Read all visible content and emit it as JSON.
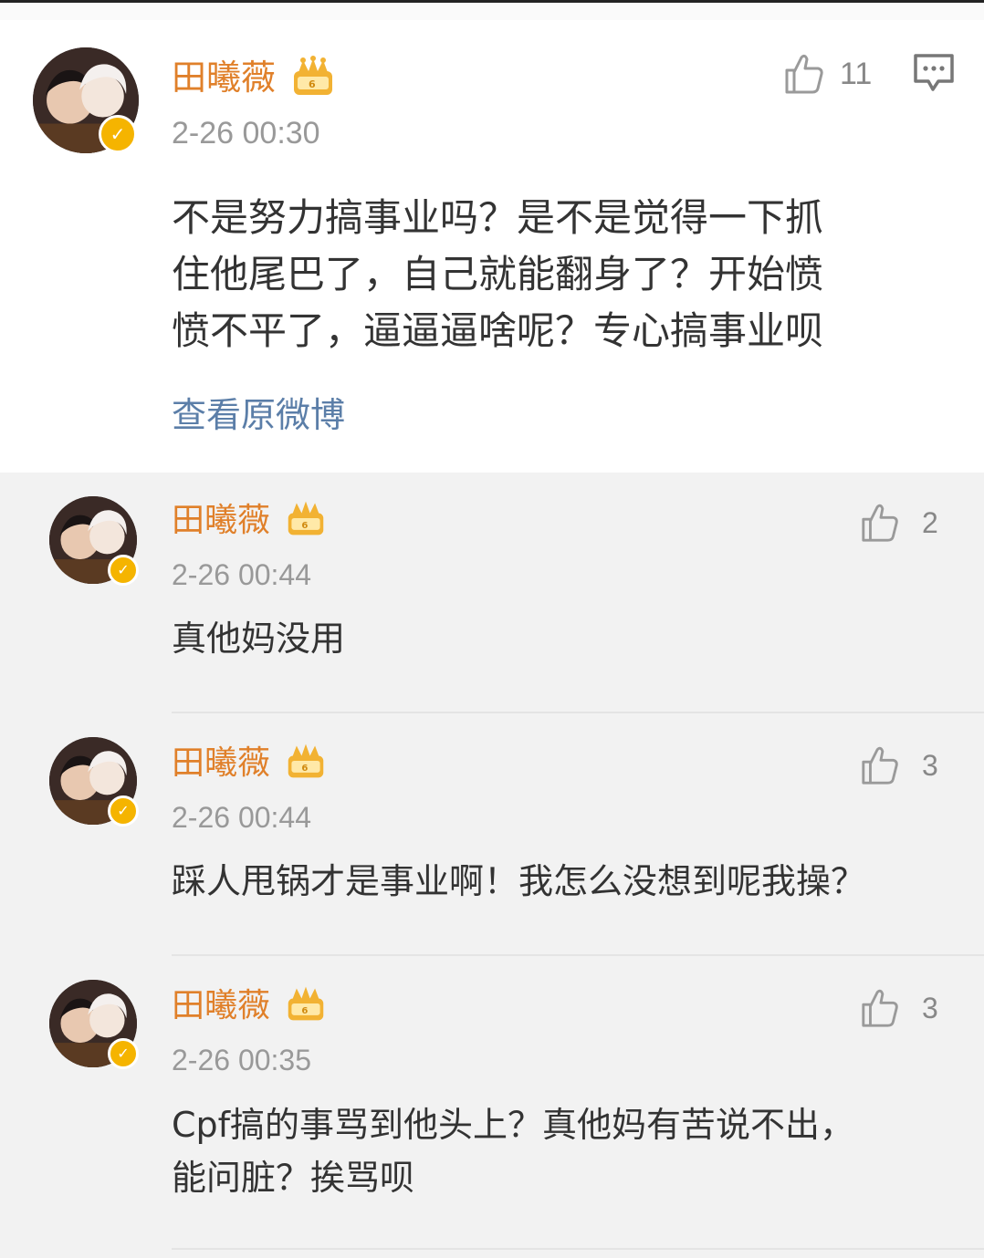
{
  "main_post": {
    "username": "田曦薇",
    "timestamp": "2-26 00:30",
    "likes": "11",
    "content_lines": [
      "不是努力搞事业吗？是不是觉得一下抓",
      "住他尾巴了，自己就能翻身了？开始愤",
      "愤不平了，逼逼逼啥呢？专心搞事业呗"
    ],
    "view_original": "查看原微博"
  },
  "replies": [
    {
      "username": "田曦薇",
      "timestamp": "2-26 00:44",
      "likes": "2",
      "lines": [
        "真他妈没用"
      ]
    },
    {
      "username": "田曦薇",
      "timestamp": "2-26 00:44",
      "likes": "3",
      "lines": [
        "踩人甩锅才是事业啊！我怎么没想到呢我操？"
      ]
    },
    {
      "username": "田曦薇",
      "timestamp": "2-26 00:35",
      "likes": "3",
      "lines": [
        "Cpf搞的事骂到他头上？真他妈有苦说不出，",
        "能问脏？挨骂呗"
      ]
    }
  ],
  "colors": {
    "username": "#e0802a",
    "timestamp": "#999999",
    "link": "#5b7ea8",
    "badge": "#f5b400"
  },
  "icons": [
    "thumbs-up-icon",
    "comment-icon",
    "crown-badge-icon",
    "verified-badge-icon"
  ]
}
